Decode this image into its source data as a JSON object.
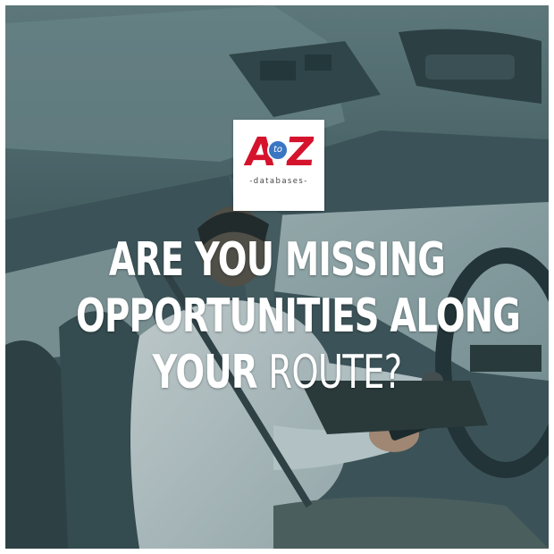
{
  "logo": {
    "letter_a": "A",
    "badge": "to",
    "letter_z": "Z",
    "tagline": "-databases-"
  },
  "headline": {
    "line1": "ARE YOU MISSING",
    "line2": "OPPORTUNITIES ALONG",
    "line3_bold": "YOUR ",
    "line3_light": "ROUTE?"
  },
  "colors": {
    "brand_red": "#d5132d",
    "brand_blue": "#3a76c2",
    "text": "#ffffff"
  }
}
